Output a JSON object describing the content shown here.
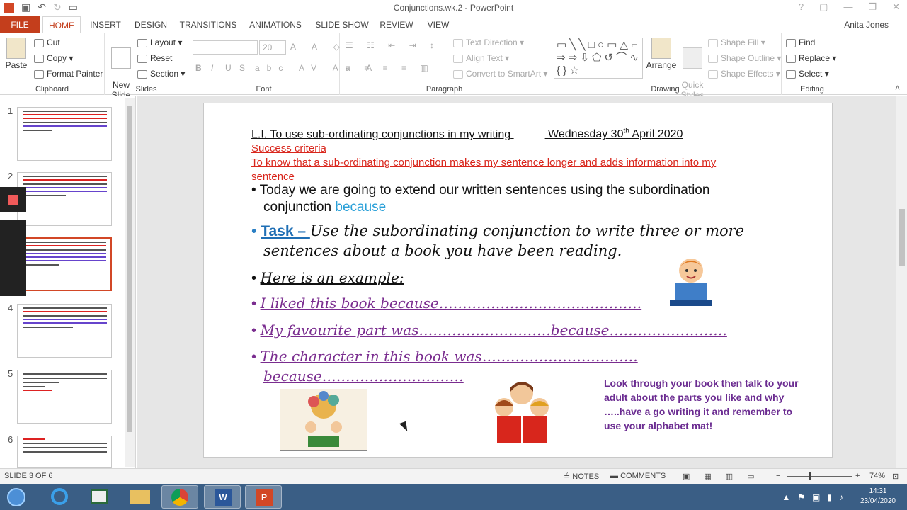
{
  "window": {
    "title": "Conjunctions.wk.2 - PowerPoint"
  },
  "tabs": [
    "FILE",
    "HOME",
    "INSERT",
    "DESIGN",
    "TRANSITIONS",
    "ANIMATIONS",
    "SLIDE SHOW",
    "REVIEW",
    "VIEW"
  ],
  "user": "Anita Jones",
  "ribbon": {
    "clipboard": {
      "paste": "Paste",
      "cut": "Cut",
      "copy": "Copy",
      "format_painter": "Format Painter",
      "label": "Clipboard"
    },
    "slides": {
      "new_slide": "New\nSlide",
      "layout": "Layout",
      "reset": "Reset",
      "section": "Section",
      "label": "Slides"
    },
    "font": {
      "size": "20",
      "label": "Font",
      "bold": "B",
      "italic": "I",
      "underline": "U",
      "shadow": "S"
    },
    "paragraph": {
      "text_direction": "Text Direction",
      "align_text": "Align Text",
      "convert_smartart": "Convert to SmartArt",
      "label": "Paragraph"
    },
    "drawing": {
      "arrange": "Arrange",
      "quick_styles": "Quick\nStyles",
      "shape_fill": "Shape Fill",
      "shape_outline": "Shape Outline",
      "shape_effects": "Shape Effects",
      "label": "Drawing"
    },
    "editing": {
      "find": "Find",
      "replace": "Replace",
      "select": "Select",
      "label": "Editing"
    }
  },
  "thumbnails": [
    "1",
    "2",
    "3",
    "4",
    "5",
    "6"
  ],
  "slide": {
    "heading_left": "L.I. To use sub-ordinating conjunctions in my writing",
    "heading_date": "Wednesday 30",
    "heading_sup": "th",
    "heading_date_end": " April 2020",
    "success": "Success criteria",
    "criteria_1": "To know that a sub-ordinating conjunction makes my sentence longer and adds information into my",
    "criteria_2": "sentence",
    "b1_1": "Today we are going to extend our written sentences using the subordination",
    "b1_2": "conjunction ",
    "b1_link": "because",
    "task_label": "Task – ",
    "task_1": "Use the subordinating conjunction to write three or more",
    "task_2": "sentences about a book you have been reading.",
    "example": "Here is an example:",
    "ex1": "I liked this book because…………………………………….",
    "ex2": " My favourite part was……………………….because…………………….",
    "ex3_1": "The character in this book was……………………………",
    "ex3_2": "because…………………………",
    "tip": "Look through your book then talk to your adult about the parts you like and why …..have a go writing it and remember to use your alphabet mat!"
  },
  "status": {
    "slide": "SLIDE 3 OF 6",
    "notes": "NOTES",
    "comments": "COMMENTS",
    "zoom": "74%"
  },
  "clock": {
    "time": "14:31",
    "date": "23/04/2020"
  }
}
